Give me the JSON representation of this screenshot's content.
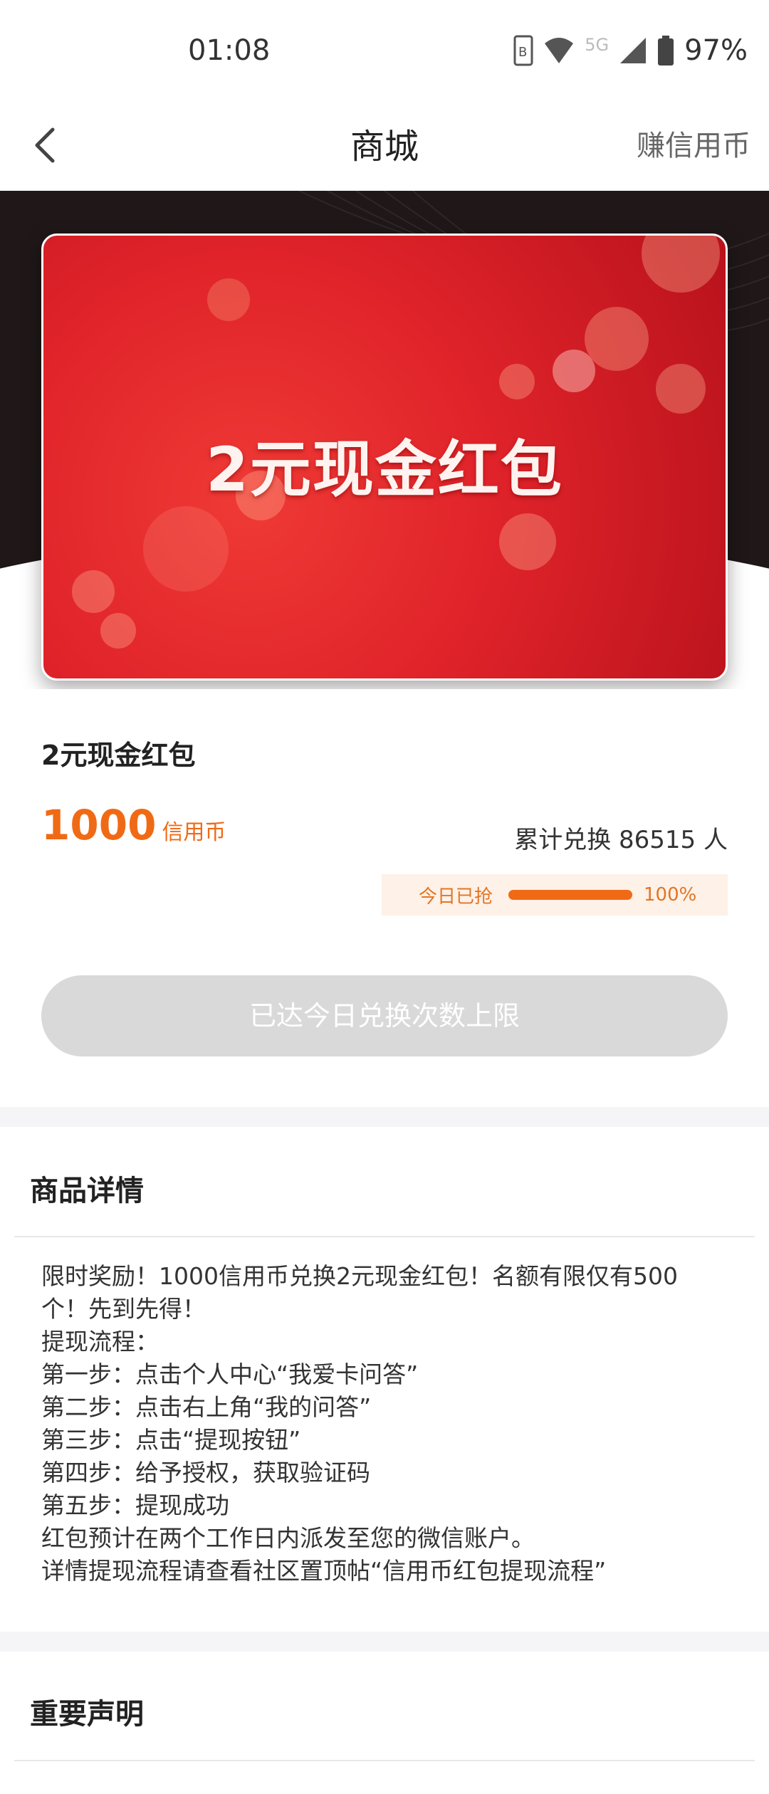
{
  "status_bar": {
    "time": "01:08",
    "network": "5G",
    "battery": "97%"
  },
  "nav": {
    "title": "商城",
    "earn": "赚信用币"
  },
  "banner": {
    "text": "2元现金红包"
  },
  "product": {
    "name": "2元现金红包",
    "price": "1000",
    "unit": "信用币",
    "total": "累计兑换 86515 人",
    "grab_label": "今日已抢",
    "grab_progress": 1.0,
    "grab_pct": "100%"
  },
  "button": {
    "label": "已达今日兑换次数上限"
  },
  "details": {
    "title": "商品详情",
    "lines": [
      "限时奖励！1000信用币兑换2元现金红包！名额有限仅有500",
      "个！先到先得！",
      "提现流程：",
      "第一步：点击个人中心“我爱卡问答”",
      "第二步：点击右上角“我的问答”",
      "第三步：点击“提现按钮”",
      "第四步：给予授权，获取验证码",
      "第五步：提现成功",
      "红包预计在两个工作日内派发至您的微信账户。",
      "详情提现流程请查看社区置顶帖“信用币红包提现流程”"
    ]
  },
  "statement": {
    "title": "重要声明"
  },
  "colors": {
    "accent": "#f06a15",
    "card_red": "#e0232a",
    "disabled_button": "#d9d9d9"
  }
}
